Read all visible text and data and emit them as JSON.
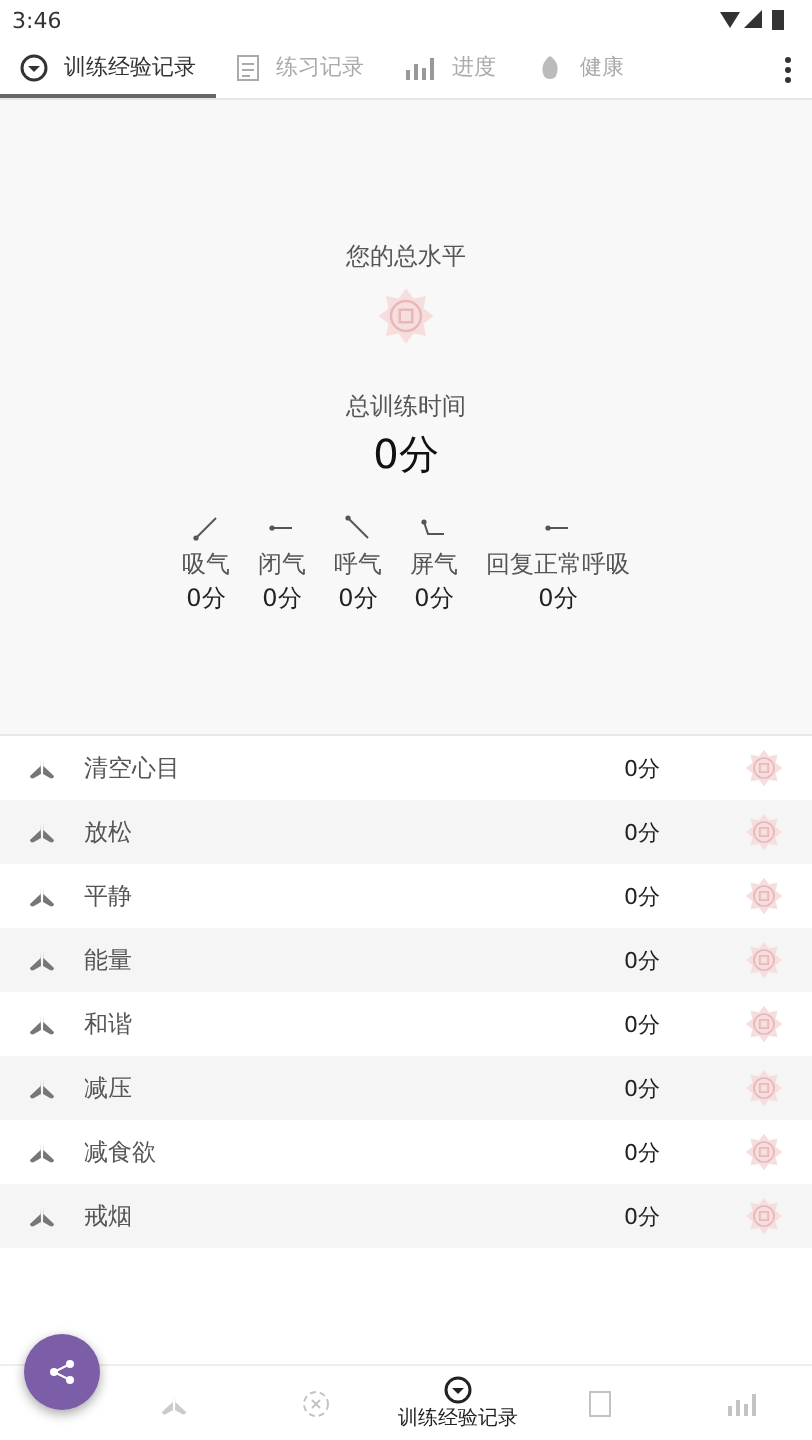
{
  "status_bar": {
    "time": "3:46"
  },
  "tabs": [
    {
      "label": "训练经验记录",
      "selected": true
    },
    {
      "label": "练习记录",
      "selected": false
    },
    {
      "label": "进度",
      "selected": false
    },
    {
      "label": "健康",
      "selected": false
    }
  ],
  "summary": {
    "level_label": "您的总水平",
    "time_label": "总训练时间",
    "total": "0分",
    "phases": [
      {
        "name": "吸气",
        "value": "0分"
      },
      {
        "name": "闭气",
        "value": "0分"
      },
      {
        "name": "呼气",
        "value": "0分"
      },
      {
        "name": "屏气",
        "value": "0分"
      },
      {
        "name": "回复正常呼吸",
        "value": "0分"
      }
    ]
  },
  "exercises": [
    {
      "name": "清空心目",
      "time": "0分"
    },
    {
      "name": "放松",
      "time": "0分"
    },
    {
      "name": "平静",
      "time": "0分"
    },
    {
      "name": "能量",
      "time": "0分"
    },
    {
      "name": "和谐",
      "time": "0分"
    },
    {
      "name": "减压",
      "time": "0分"
    },
    {
      "name": "减食欲",
      "time": "0分"
    },
    {
      "name": "戒烟",
      "time": "0分"
    }
  ],
  "bottom_nav": [
    {
      "selected": false
    },
    {
      "selected": false
    },
    {
      "label": "训练经验记录",
      "selected": true
    },
    {
      "selected": false
    },
    {
      "selected": false
    }
  ]
}
